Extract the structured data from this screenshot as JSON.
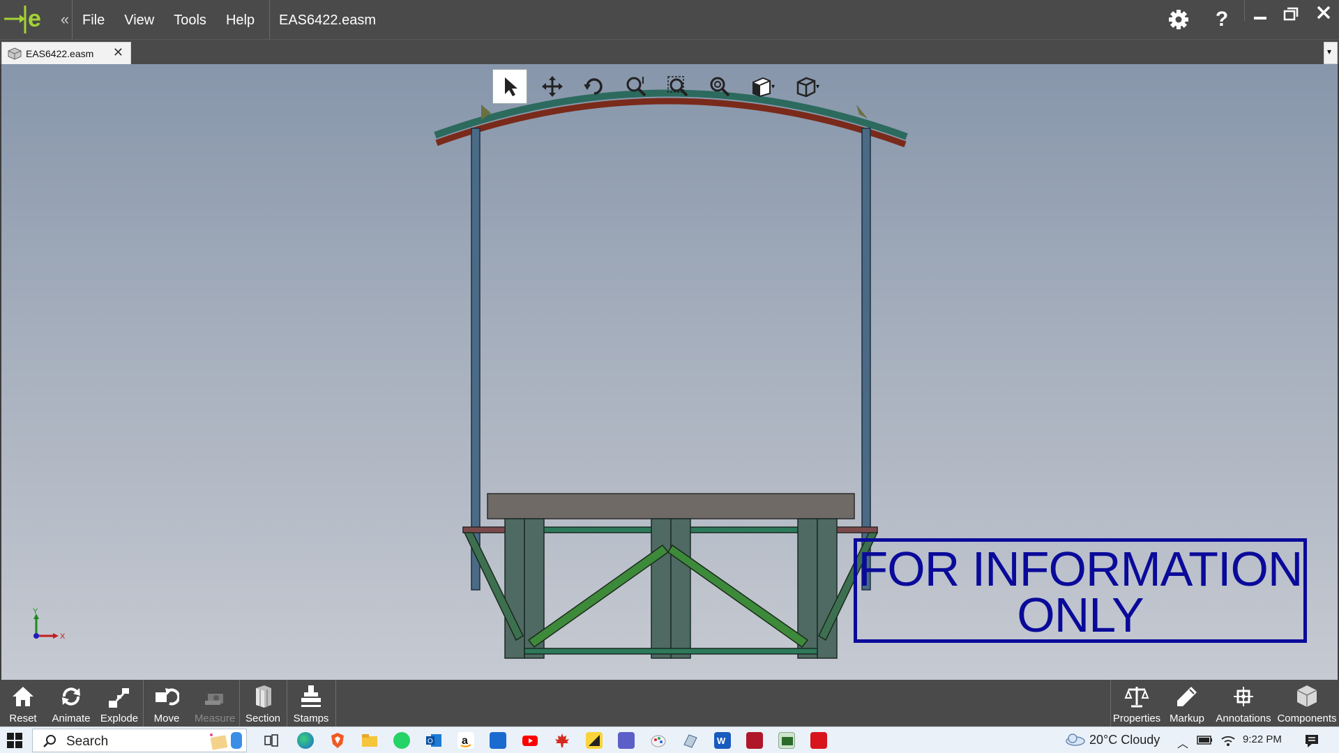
{
  "app": {
    "logo_icon": "edrawings-logo-icon",
    "collapse_glyph": "«",
    "menu": [
      "File",
      "View",
      "Tools",
      "Help"
    ],
    "document_title": "EAS6422.easm",
    "settings_icon": "gear-icon",
    "help_glyph": "?",
    "window_controls": [
      "minimize-icon",
      "restore-icon",
      "close-icon"
    ]
  },
  "tab": {
    "label": "EAS6422.easm",
    "close_glyph": "✕",
    "dropdown_glyph": "▾"
  },
  "view_toolbar": {
    "tools": [
      "select-icon",
      "pan-icon",
      "rotate-icon",
      "zoom-to-fit-icon",
      "zoom-to-area-icon",
      "zoom-icon",
      "display-style-icon",
      "view-orientation-icon"
    ]
  },
  "viewport": {
    "stamp_text": "FOR INFORMATION ONLY",
    "stamp_color": "#0a0a9a",
    "triad_labels": {
      "y": "Y",
      "x": "X"
    }
  },
  "commands": {
    "left": [
      {
        "label": "Reset",
        "icon": "home-icon",
        "enabled": true
      },
      {
        "label": "Animate",
        "icon": "animate-icon",
        "enabled": true
      },
      {
        "label": "Explode",
        "icon": "explode-icon",
        "enabled": true
      },
      {
        "label": "Move",
        "icon": "move-icon",
        "enabled": true
      },
      {
        "label": "Measure",
        "icon": "measure-icon",
        "enabled": false
      },
      {
        "label": "Section",
        "icon": "section-icon",
        "enabled": true
      },
      {
        "label": "Stamps",
        "icon": "stamp-icon",
        "enabled": true
      }
    ],
    "right": [
      {
        "label": "Properties",
        "icon": "scale-icon",
        "enabled": true
      },
      {
        "label": "Markup",
        "icon": "pencil-icon",
        "enabled": true
      },
      {
        "label": "Annotations",
        "icon": "annotations-icon",
        "enabled": true
      },
      {
        "label": "Components",
        "icon": "components-icon",
        "enabled": true
      }
    ]
  },
  "taskbar": {
    "search_label": "Search",
    "weather": "20°C  Cloudy",
    "time": "9:22 PM",
    "apps": [
      "task-view-icon",
      "edge-icon",
      "brave-icon",
      "file-explorer-icon",
      "whatsapp-icon",
      "outlook-icon",
      "amazon-icon",
      "store-icon",
      "youtube-icon",
      "maple-leaf-icon",
      "sticky-notes-icon",
      "teams-icon",
      "paint-icon",
      "feedback-icon",
      "word-icon",
      "app-2016-icon",
      "edrawings-2016-icon",
      "solidworks-icon"
    ]
  },
  "colors": {
    "chrome": "#4a4a4a",
    "accent_logo": "#a4d233",
    "steel_column": "#4a6a86",
    "beam_green": "#2c7a5a",
    "roof_red": "#7a2a1a",
    "deck_gray": "#6f6a66",
    "brace_green": "#3d8a3a"
  }
}
